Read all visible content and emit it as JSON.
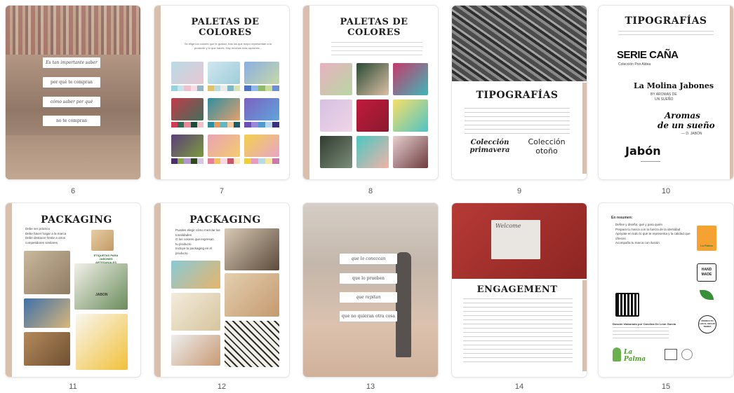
{
  "pages": [
    {
      "number": "6",
      "buttons": [
        "Es tan importante saber",
        "por qué te compran",
        "cómo saber por qué",
        "no te compran"
      ]
    },
    {
      "number": "7",
      "title_line1": "PALETAS DE",
      "title_line2": "COLORES",
      "intro": "Se elige los colores que te gustan, tras los que mejor representan a tu producto y lo que haces. Hay muchas más opciones..."
    },
    {
      "number": "8",
      "title_line1": "PALETAS DE",
      "title_line2": "COLORES"
    },
    {
      "number": "9",
      "title": "TIPOGRAFÍAS",
      "font1_line1": "Colección",
      "font1_line2": "primavera",
      "font2_line1": "Colección",
      "font2_line2": "otoño"
    },
    {
      "number": "10",
      "title": "TIPOGRAFÍAS",
      "sample1": "SERIE CAÑA",
      "sample1_sub": "Colección Pon Aldea",
      "sample2": "La Molina Jabones",
      "sample2_sub1": "BY AROMAS DE",
      "sample2_sub2": "UN SUEÑO",
      "sample3_line1": "Aromas",
      "sample3_line2": "de un sueño",
      "sample3_sub": "— D. JABÓN",
      "sample4": "Jabón"
    },
    {
      "number": "11",
      "title": "PACKAGING",
      "bullets": [
        "Debe ser práctico",
        "Debe hacer hogar a la marca",
        "Debe destacar frente a otros",
        "competidores similares"
      ],
      "label": "ETIQUETAS PARA JABONES ARTESANALES",
      "box_text": "JABON"
    },
    {
      "number": "12",
      "title": "PACKAGING",
      "bullets": [
        "Puedes elegir cómo mezclar las tonalidades",
        "O los colores que expresan",
        "tu producto",
        "Incluye tu packaging en el",
        "producto"
      ]
    },
    {
      "number": "13",
      "buttons": [
        "que lo conozcan",
        "que lo prueben",
        "que repitan",
        "que no quieran otra cosa"
      ]
    },
    {
      "number": "14",
      "title": "ENGAGEMENT",
      "card_text": "Welcome"
    },
    {
      "number": "15",
      "heading": "En resumen:",
      "bullets": [
        "Define y diseña: qué y para quién",
        "Prepara tu marca con la fuerza de la identidad",
        "Apóyate en todo lo que te representa y la calidad que ofreces",
        "Acompaña tu marca con ilusión"
      ],
      "credit": "Dossier elaborado por Carolina De León García",
      "logo1": "La Palma",
      "badge1_line1": "HAND",
      "badge1_line2": "MADE",
      "badge2": "PRODUCTO LOCAL HECHO TIERRA",
      "logo2": "La Palma"
    }
  ]
}
